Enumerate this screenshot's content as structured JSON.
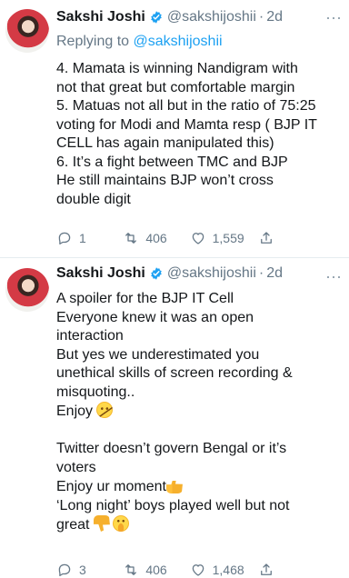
{
  "colors": {
    "accent": "#1da1f2",
    "muted": "#657786",
    "divider": "#e6ecf0"
  },
  "tweets": [
    {
      "name": "Sakshi Joshi",
      "handle": "@sakshijoshii",
      "dot": "·",
      "age": "2d",
      "more": "···",
      "replying_prefix": "Replying to ",
      "replying_to": "@sakshijoshii",
      "text": "4. Mamata is winning Nandigram with\nnot that great but comfortable margin\n5. Matuas not all but in the ratio of 75:25\nvoting for Modi and Mamta resp ( BJP IT\nCELL has again manipulated this)\n6. It’s a fight between TMC and BJP\nHe still maintains BJP won’t cross\ndouble digit",
      "replies": "1",
      "retweets": "406",
      "likes": "1,559"
    },
    {
      "name": "Sakshi Joshi",
      "handle": "@sakshijoshii",
      "dot": "·",
      "age": "2d",
      "more": "···",
      "text_part1": "A spoiler for the BJP IT Cell\nEveryone knew it was an open\ninteraction\nBut yes we underestimated you\nunethical skills of screen recording &\nmisquoting..\nEnjoy ",
      "text_part2": "\n\nTwitter doesn’t govern Bengal or it’s\nvoters\nEnjoy ur moment",
      "text_part3": "\n‘Long night’ boys played well but not\ngreat ",
      "replies": "3",
      "retweets": "406",
      "likes": "1,468"
    }
  ],
  "icons": [
    "avatar-photo",
    "verified-icon",
    "more-icon",
    "reply-icon",
    "retweet-icon",
    "like-icon",
    "share-icon",
    "smirk-emoji-icon",
    "thumbs-up-emoji-icon",
    "thumbs-down-emoji-icon",
    "hand-over-mouth-emoji-icon"
  ]
}
